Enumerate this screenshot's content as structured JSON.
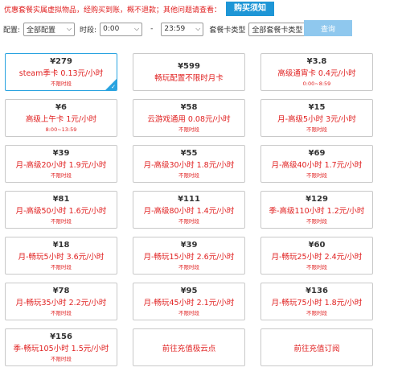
{
  "notice": {
    "text": "优惠套餐实属虚拟物品，经购买到账，概不退款；其他问题请查看：",
    "button_label": "购买须知"
  },
  "filter": {
    "config_label": "配置:",
    "config_value": "全部配置",
    "time_label": "时段:",
    "time_start": "0:00",
    "time_separator": "-",
    "time_end": "23:59",
    "card_type_label": "套餐卡类型",
    "card_type_value": "全部套餐卡类型",
    "search_label": "查询"
  },
  "cards": [
    {
      "price": "¥279",
      "name": "steam季卡 0.13元/小时",
      "time": "不限时段",
      "selected": true
    },
    {
      "price": "¥599",
      "name": "畅玩配置不限时月卡",
      "time": "",
      "selected": false
    },
    {
      "price": "¥3.8",
      "name": "高级通宵卡 0.4元/小时",
      "time": "0:00~8:59",
      "selected": false
    },
    {
      "price": "¥6",
      "name": "高级上午卡 1元/小时",
      "time": "8:00~13:59",
      "selected": false
    },
    {
      "price": "¥58",
      "name": "云游戏通用 0.08元/小时",
      "time": "不限时段",
      "selected": false
    },
    {
      "price": "¥15",
      "name": "月-高级5小时 3元/小时",
      "time": "不限时段",
      "selected": false
    },
    {
      "price": "¥39",
      "name": "月-高级20小时 1.9元/小时",
      "time": "不限时段",
      "selected": false
    },
    {
      "price": "¥55",
      "name": "月-高级30小时 1.8元/小时",
      "time": "不限时段",
      "selected": false
    },
    {
      "price": "¥69",
      "name": "月-高级40小时 1.7元/小时",
      "time": "不限时段",
      "selected": false
    },
    {
      "price": "¥81",
      "name": "月-高级50小时 1.6元/小时",
      "time": "不限时段",
      "selected": false
    },
    {
      "price": "¥111",
      "name": "月-高级80小时 1.4元/小时",
      "time": "不限时段",
      "selected": false
    },
    {
      "price": "¥129",
      "name": "季-高级110小时 1.2元/小时",
      "time": "不限时段",
      "selected": false
    },
    {
      "price": "¥18",
      "name": "月-畅玩5小时 3.6元/小时",
      "time": "不限时段",
      "selected": false
    },
    {
      "price": "¥39",
      "name": "月-畅玩15小时 2.6元/小时",
      "time": "不限时段",
      "selected": false
    },
    {
      "price": "¥60",
      "name": "月-畅玩25小时 2.4元/小时",
      "time": "不限时段",
      "selected": false
    },
    {
      "price": "¥78",
      "name": "月-畅玩35小时 2.2元/小时",
      "time": "不限时段",
      "selected": false
    },
    {
      "price": "¥95",
      "name": "月-畅玩45小时 2.1元/小时",
      "time": "不限时段",
      "selected": false
    },
    {
      "price": "¥136",
      "name": "月-畅玩75小时 1.8元/小时",
      "time": "不限时段",
      "selected": false
    },
    {
      "price": "¥156",
      "name": "季-畅玩105小时 1.5元/小时",
      "time": "不限时段",
      "selected": false
    }
  ],
  "links": [
    {
      "label": "前往充值极云点"
    },
    {
      "label": "前往充值订阅"
    }
  ],
  "colors": {
    "accent": "#1e96d6",
    "price_red": "#e02020",
    "search_button": "#8fc8ee",
    "selected_border": "#29a3e0"
  }
}
